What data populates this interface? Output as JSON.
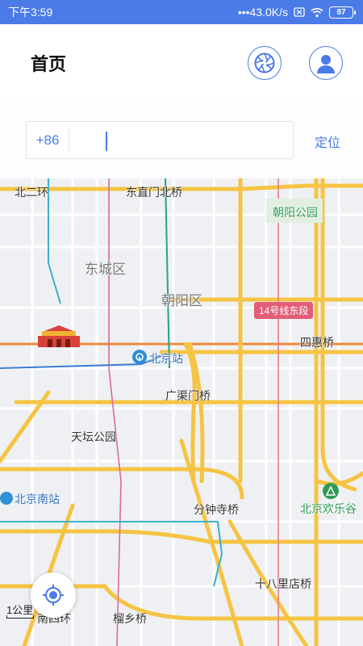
{
  "status_bar": {
    "time": "下午3:59",
    "network_speed": "•••43.0K/s",
    "battery": "87"
  },
  "header": {
    "title": "首页",
    "left_icon": "aperture-icon",
    "right_icon": "user-avatar-icon"
  },
  "phone_input": {
    "country_code": "+86",
    "value": "",
    "locate_label": "定位"
  },
  "map": {
    "labels": {
      "beierhuan": "北二环",
      "dongzhimen": "东直门北桥",
      "chaoyang_park": "朝阳公园",
      "dongcheng": "东城区",
      "chaoyang": "朝阳区",
      "line14": "14号线东段",
      "sihuiqiao": "四惠桥",
      "beijing_station": "北京站",
      "guangqumen": "广渠门桥",
      "tiantan": "天坛公园",
      "beijing_south": "北京南站",
      "fenzhongsi": "分钟寺桥",
      "happy_valley": "北京欢乐谷",
      "shibalidian": "十八里店桥",
      "nansihuan": "南四环",
      "liuxiang": "榴乡桥"
    },
    "scale_label": "1公里",
    "colors": {
      "accent": "#4a7be6",
      "highway": "#f6c443",
      "metro_badge": "#e35d78"
    }
  }
}
